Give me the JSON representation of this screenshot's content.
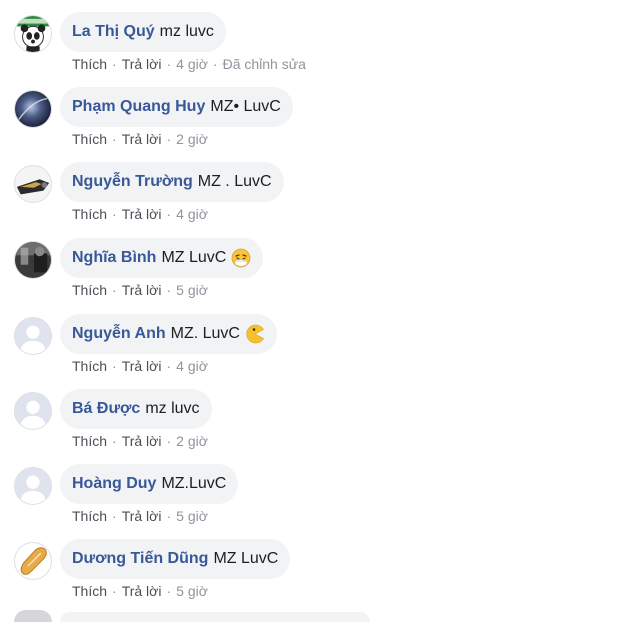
{
  "actions": {
    "like": "Thích",
    "reply": "Trả lời",
    "separator": "·"
  },
  "comments": [
    {
      "author": "La Thị Quý",
      "text": "mz luvc",
      "time": "4 giờ",
      "edited": "Đã chỉnh sửa",
      "avatar_icon": "panda-avatar-icon"
    },
    {
      "author": "Phạm Quang Huy",
      "text": "MZ• LuvC",
      "time": "2 giờ",
      "avatar_icon": "space-avatar-icon"
    },
    {
      "author": "Nguyễn Trường",
      "text": "MZ . LuvC",
      "time": "4 giờ",
      "avatar_icon": "object-avatar-icon"
    },
    {
      "author": "Nghĩa Bình",
      "text": "MZ LuvC",
      "time": "5 giờ",
      "emoji": "sneezing-face-emoji",
      "avatar_icon": "dark-photo-avatar-icon"
    },
    {
      "author": "Nguyễn Anh",
      "text": "MZ. LuvC",
      "time": "4 giờ",
      "emoji": "pacman-emoji",
      "avatar_icon": "default-avatar-icon"
    },
    {
      "author": "Bá Được",
      "text": "mz luvc",
      "time": "2 giờ",
      "avatar_icon": "default-avatar-icon"
    },
    {
      "author": "Hoàng Duy",
      "text": "MZ.LuvC",
      "time": "5 giờ",
      "avatar_icon": "default-avatar-icon"
    },
    {
      "author": "Dương Tiến Dũng",
      "text": "MZ LuvC",
      "time": "5 giờ",
      "avatar_icon": "bread-avatar-icon"
    }
  ],
  "colors": {
    "author": "#385898",
    "bubble": "#f2f3f5",
    "meta": "#90949c",
    "text": "#1c1e21"
  }
}
